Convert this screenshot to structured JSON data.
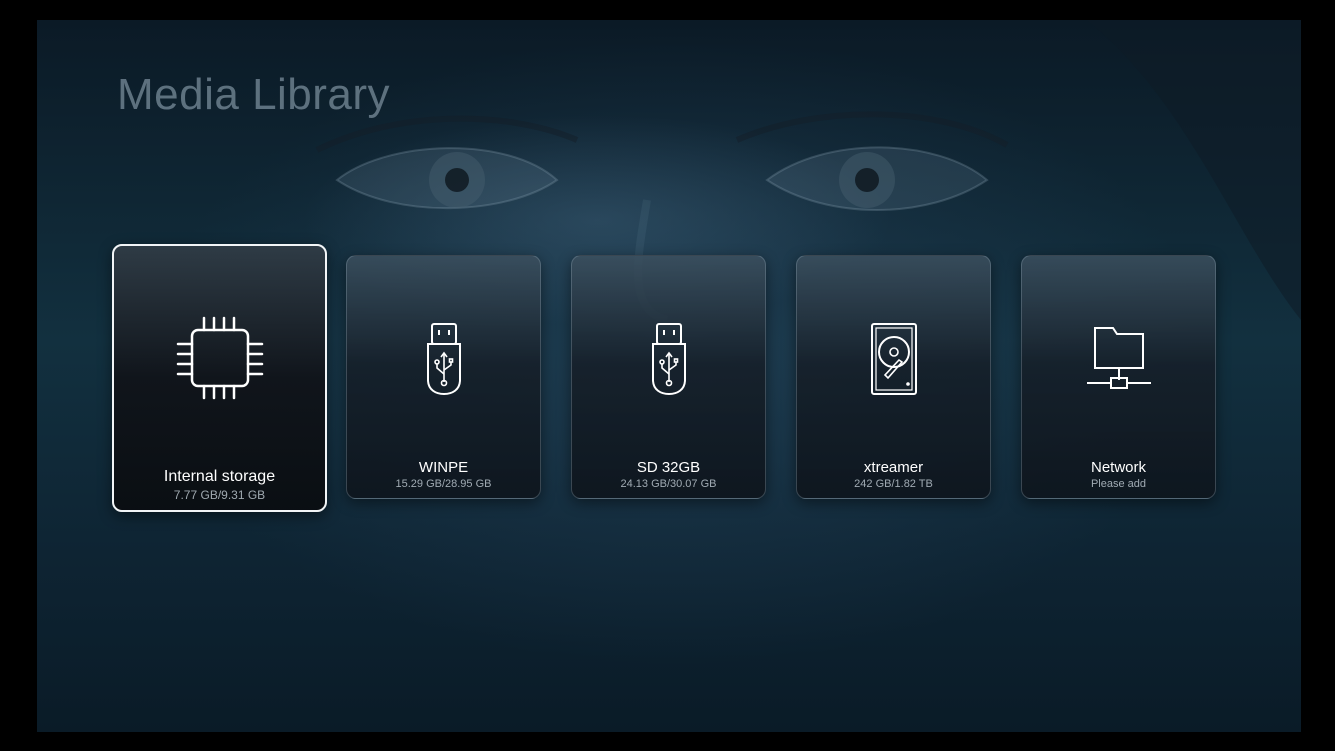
{
  "page": {
    "title": "Media Library"
  },
  "tiles": [
    {
      "label": "Internal storage",
      "detail": "7.77 GB/9.31 GB",
      "icon": "chip-icon",
      "focused": true
    },
    {
      "label": "WINPE",
      "detail": "15.29 GB/28.95 GB",
      "icon": "usb-drive-icon",
      "focused": false
    },
    {
      "label": "SD 32GB",
      "detail": "24.13 GB/30.07 GB",
      "icon": "usb-drive-icon",
      "focused": false
    },
    {
      "label": "xtreamer",
      "detail": "242 GB/1.82 TB",
      "icon": "hard-disk-icon",
      "focused": false
    },
    {
      "label": "Network",
      "detail": "Please add",
      "icon": "network-folder-icon",
      "focused": false
    }
  ],
  "colors": {
    "accent": "#f2f5f7",
    "background": "#12303f"
  }
}
